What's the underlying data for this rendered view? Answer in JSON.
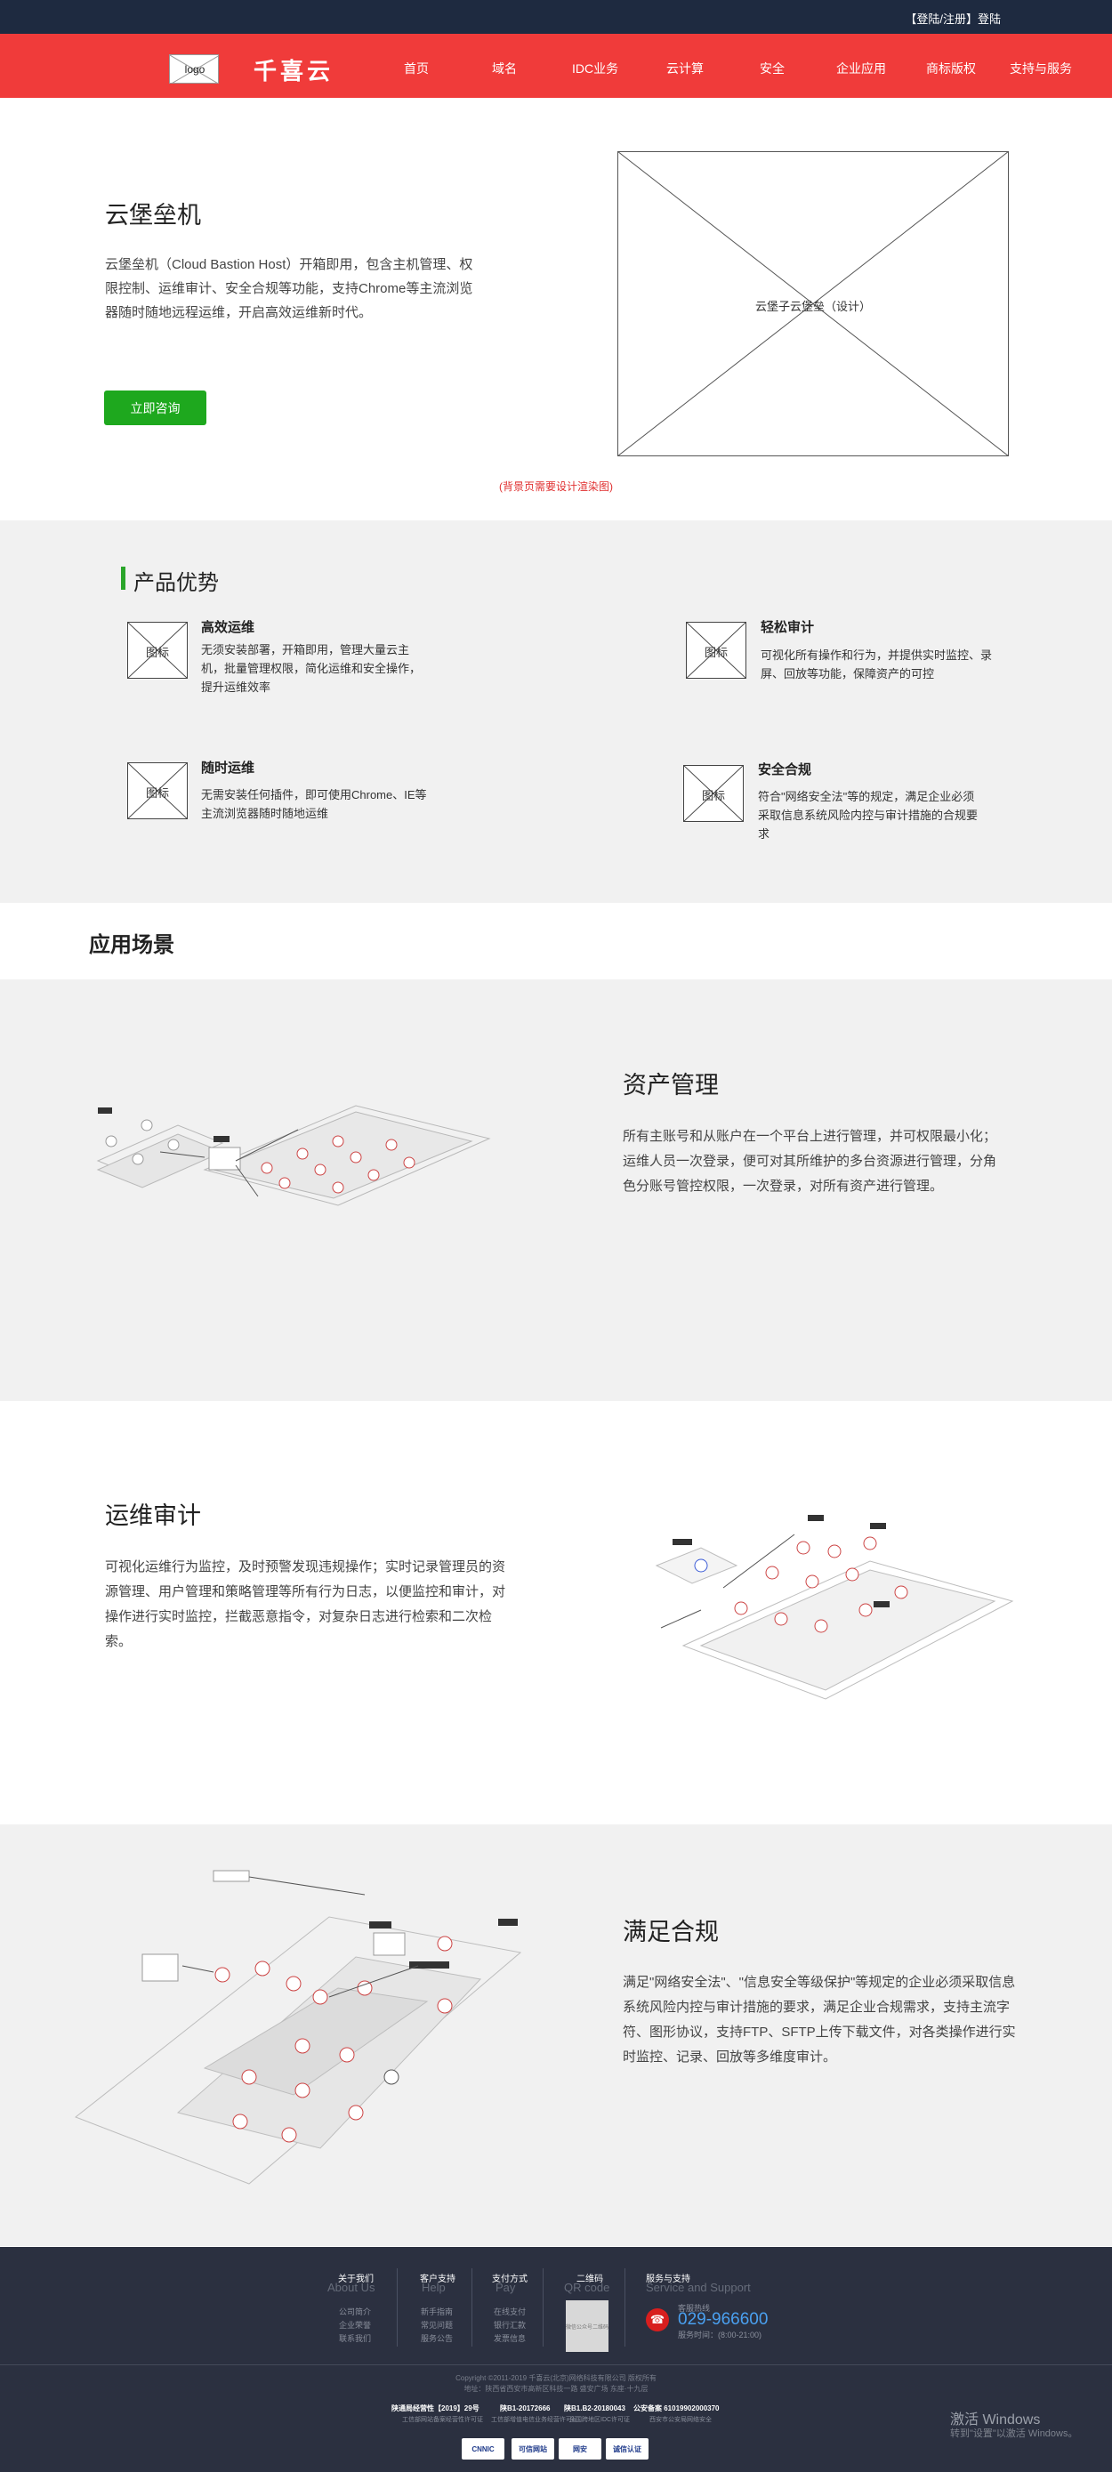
{
  "topbar": {
    "login_text": "【登陆/注册】登陆"
  },
  "nav": {
    "logo_text": "logo",
    "brand": "千喜云",
    "items": [
      "首页",
      "域名",
      "IDC业务",
      "云计算",
      "安全",
      "企业应用",
      "商标版权",
      "支持与服务"
    ]
  },
  "hero": {
    "title": "云堡垒机",
    "desc": "云堡垒机（Cloud Bastion Host）开箱即用，包含主机管理、权限控制、运维审计、安全合规等功能，支持Chrome等主流浏览器随时随地远程运维，开启高效运维新时代。",
    "cta": "立即咨询",
    "placeholder_label": "云堡子云堡垒（设计）",
    "note": "(背景页需要设计渲染图)"
  },
  "features": {
    "heading": "产品优势",
    "icon_label": "图标",
    "items": [
      {
        "title": "高效运维",
        "desc": "无须安装部署，开箱即用，管理大量云主机，批量管理权限，简化运维和安全操作，提升运维效率"
      },
      {
        "title": "轻松审计",
        "desc": "可视化所有操作和行为，并提供实时监控、录屏、回放等功能，保障资产的可控"
      },
      {
        "title": "随时运维",
        "desc": "无需安装任何插件，即可使用Chrome、IE等主流浏览器随时随地运维"
      },
      {
        "title": "安全合规",
        "desc": "符合\"网络安全法\"等的规定，满足企业必须采取信息系统风险内控与审计措施的合规要求"
      }
    ]
  },
  "scenarios": {
    "heading": "应用场景",
    "items": [
      {
        "title": "资产管理",
        "desc": "所有主账号和从账户在一个平台上进行管理，并可权限最小化；运维人员一次登录，便可对其所维护的多台资源进行管理，分角色分账号管控权限，一次登录，对所有资产进行管理。"
      },
      {
        "title": "运维审计",
        "desc": "可视化运维行为监控，及时预警发现违规操作；实时记录管理员的资源管理、用户管理和策略管理等所有行为日志，以便监控和审计，对操作进行实时监控，拦截恶意指令，对复杂日志进行检索和二次检索。"
      },
      {
        "title": "满足合规",
        "desc": "满足\"网络安全法\"、\"信息安全等级保护\"等规定的企业必须采取信息系统风险内控与审计措施的要求，满足企业合规需求，支持主流字符、图形协议，支持FTP、SFTP上传下载文件，对各类操作进行实时监控、记录、回放等多维度审计。"
      }
    ]
  },
  "footer": {
    "columns": [
      {
        "title": "关于我们",
        "en": "About Us",
        "links": [
          "公司简介",
          "企业荣誉",
          "联系我们"
        ]
      },
      {
        "title": "客户支持",
        "en": "Help",
        "links": [
          "新手指南",
          "常见问题",
          "服务公告"
        ]
      },
      {
        "title": "支付方式",
        "en": "Pay",
        "links": [
          "在线支付",
          "银行汇款",
          "发票信息"
        ]
      },
      {
        "title": "二维码",
        "en": "QR code",
        "links": []
      },
      {
        "title": "服务与支持",
        "en": "Service and Support",
        "links": []
      }
    ],
    "qr_label": "微信公众号二维码",
    "phone_label": "客服热线",
    "phone": "029-966600",
    "phone_hours": "服务时间：(8:00-21:00)",
    "copyright": "Copyright ©2011-2019 千喜云(北京)网络科技有限公司 版权所有",
    "address": "地址：陕西省西安市高新区科技一路 盛安广场 东座·十九层",
    "licenses": [
      {
        "main": "陕通局经营性【2019】29号",
        "sub": "工信部网站备案经营性许可证"
      },
      {
        "main": "陕B1-20172666",
        "sub": "工信部增值电信业务经营许可证"
      },
      {
        "main": "陕B1.B2-20180043",
        "sub": "全国跨地区IDC许可证"
      },
      {
        "main": "公安备案 61019902000370",
        "sub": "西安市公安局网络安全"
      }
    ],
    "badges": [
      "CNNIC",
      "可信网站",
      "网安",
      "诚信认证"
    ]
  },
  "overlay": {
    "activate": "激活 Windows",
    "activate_sub": "转到\"设置\"以激活 Windows。"
  },
  "colors": {
    "nav_red": "#f03b3a",
    "topbar_navy": "#1e2a40",
    "cta_green": "#1ea81e",
    "footer_bg": "#2b3040"
  }
}
